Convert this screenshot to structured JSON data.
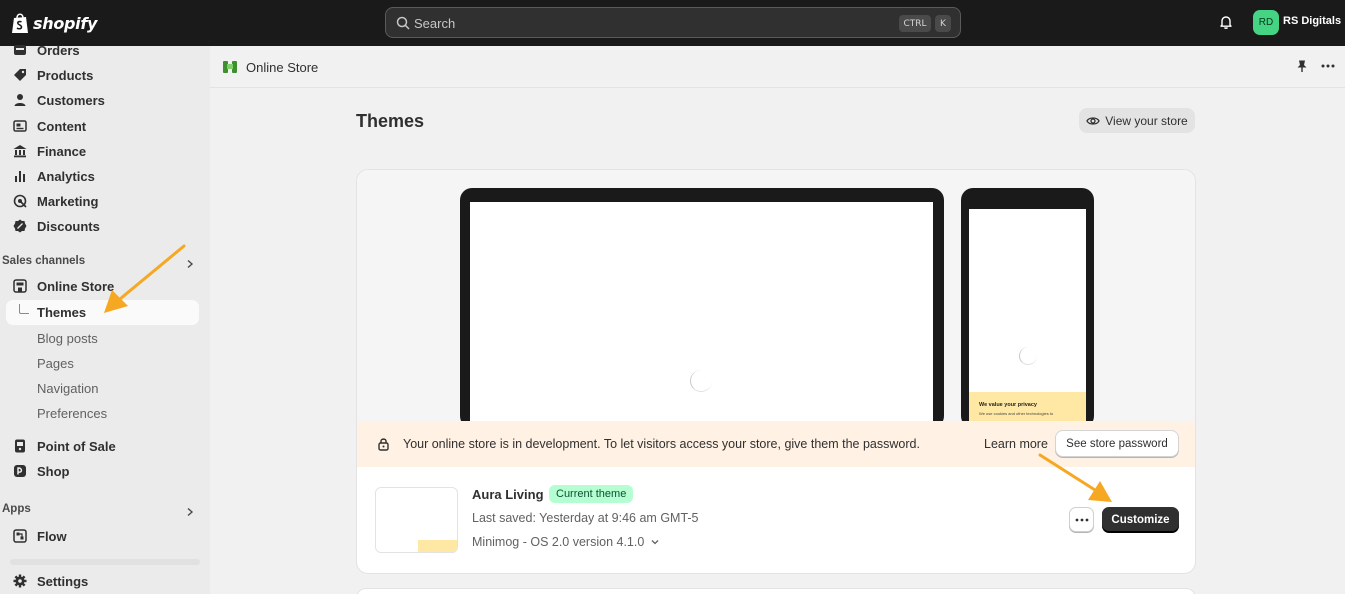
{
  "topbar": {
    "logo_text": "shopify",
    "search_placeholder": "Search",
    "shortcut_ctrl": "CTRL",
    "shortcut_key": "K",
    "avatar_initials": "RD",
    "store_name": "RS Digitals",
    "icons": [
      "shopify-bag-icon",
      "search-icon",
      "bell-icon"
    ]
  },
  "sidebar": {
    "items": [
      {
        "label": "Orders",
        "icon": "orders-icon"
      },
      {
        "label": "Products",
        "icon": "tag-icon"
      },
      {
        "label": "Customers",
        "icon": "person-icon"
      },
      {
        "label": "Content",
        "icon": "content-icon"
      },
      {
        "label": "Finance",
        "icon": "bank-icon"
      },
      {
        "label": "Analytics",
        "icon": "bar-chart-icon"
      },
      {
        "label": "Marketing",
        "icon": "target-icon"
      },
      {
        "label": "Discounts",
        "icon": "discount-icon"
      }
    ],
    "sales_channels_heading": "Sales channels",
    "online_store": "Online Store",
    "sub_items": [
      "Themes",
      "Blog posts",
      "Pages",
      "Navigation",
      "Preferences"
    ],
    "point_of_sale": "Point of Sale",
    "shop": "Shop",
    "apps_heading": "Apps",
    "flow": "Flow",
    "settings": "Settings"
  },
  "header": {
    "title": "Online Store"
  },
  "main": {
    "page_title": "Themes",
    "view_store_label": "View your store",
    "preview": {
      "privacy_title": "We value your privacy",
      "privacy_text": "We use cookies and other technologies to"
    },
    "banner": {
      "message": "Your online store is in development. To let visitors access your store, give them the password.",
      "learn_more": "Learn more",
      "button": "See store password"
    },
    "theme": {
      "name": "Aura Living",
      "badge": "Current theme",
      "last_saved": "Last saved: Yesterday at 9:46 am GMT-5",
      "version": "Minimog - OS 2.0 version 4.1.0",
      "customize_label": "Customize"
    }
  },
  "colors": {
    "topbar": "#1a1a1a",
    "badge_bg": "#b4fed2",
    "banner_bg": "#fff1e3",
    "annotation_arrow": "#f6a823"
  }
}
